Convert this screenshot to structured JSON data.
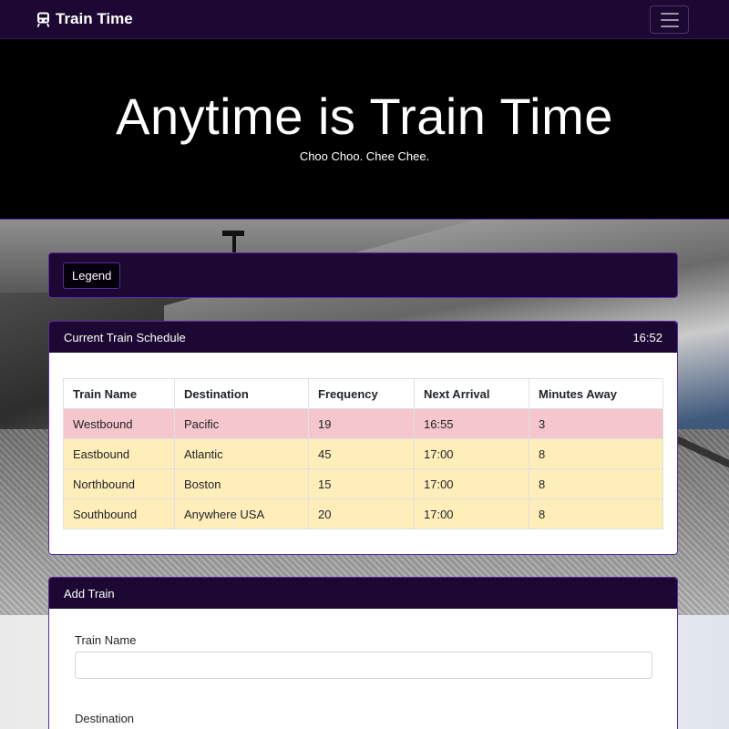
{
  "navbar": {
    "brand": "Train Time",
    "toggle_icon": "hamburger-icon",
    "brand_icon": "train-icon"
  },
  "jumbotron": {
    "title": "Anytime is Train Time",
    "subtitle": "Choo Choo. Chee Chee."
  },
  "legend": {
    "button_label": "Legend"
  },
  "schedule": {
    "header": "Current Train Schedule",
    "time": "16:52",
    "columns": [
      "Train Name",
      "Destination",
      "Frequency",
      "Next Arrival",
      "Minutes Away"
    ],
    "rows": [
      {
        "name": "Westbound",
        "destination": "Pacific",
        "frequency": "19",
        "next_arrival": "16:55",
        "minutes_away": "3",
        "status": "danger"
      },
      {
        "name": "Eastbound",
        "destination": "Atlantic",
        "frequency": "45",
        "next_arrival": "17:00",
        "minutes_away": "8",
        "status": "warning"
      },
      {
        "name": "Northbound",
        "destination": "Boston",
        "frequency": "15",
        "next_arrival": "17:00",
        "minutes_away": "8",
        "status": "warning"
      },
      {
        "name": "Southbound",
        "destination": "Anywhere USA",
        "frequency": "20",
        "next_arrival": "17:00",
        "minutes_away": "8",
        "status": "warning"
      }
    ]
  },
  "add_train": {
    "header": "Add Train",
    "train_name_label": "Train Name",
    "train_name_value": "",
    "destination_label": "Destination"
  },
  "colors": {
    "nav_bg": "#1c0832",
    "accent_border": "#5b2aa3",
    "danger_row": "#f5c6cb",
    "warning_row": "#ffeeba"
  }
}
